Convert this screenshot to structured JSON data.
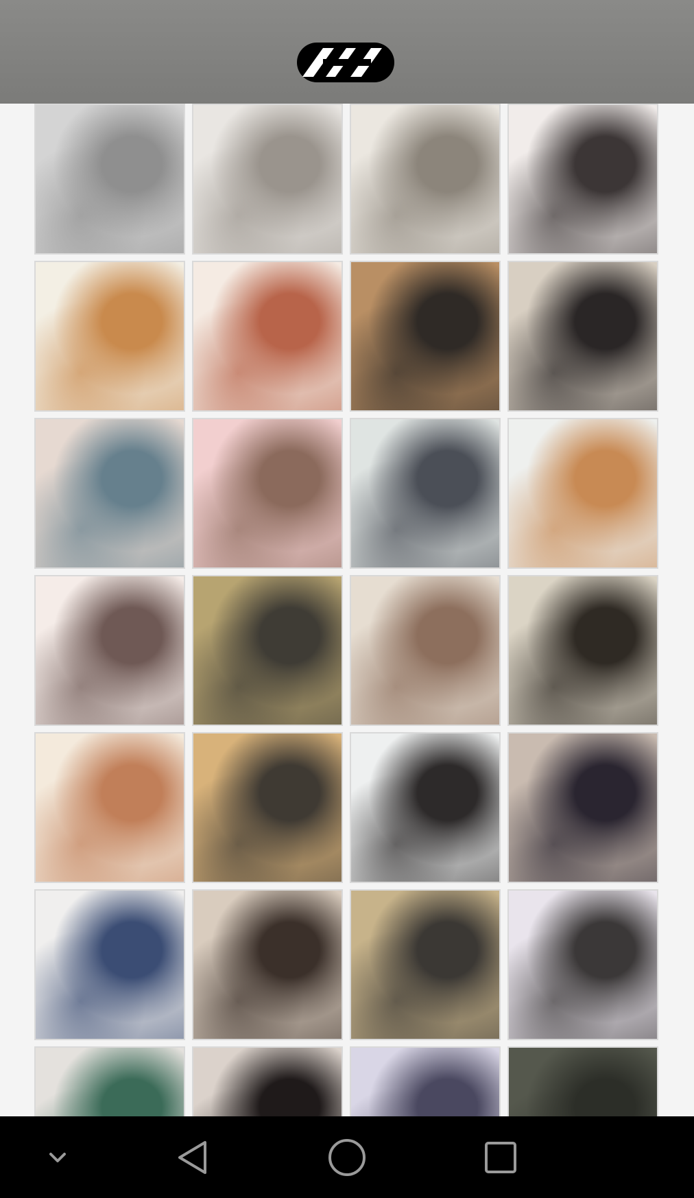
{
  "header": {
    "logo_icon": "app-logo-icon",
    "background": "#838381"
  },
  "gallery": {
    "columns": 4,
    "tiles": [
      {
        "icon": "photo-woman-grey-cat",
        "tone": [
          "#d4d4d4",
          "#8f8f8f"
        ]
      },
      {
        "icon": "photo-girl-cat-on-bed",
        "tone": [
          "#e9e6e2",
          "#9a948d"
        ]
      },
      {
        "icon": "photo-girl-cat-book",
        "tone": [
          "#ebe7e0",
          "#8c857b"
        ]
      },
      {
        "icon": "photo-girl-white-cat",
        "tone": [
          "#f1ecea",
          "#3c3636"
        ]
      },
      {
        "icon": "photo-girl-calico-cat",
        "tone": [
          "#f3efe4",
          "#c98a4d"
        ]
      },
      {
        "icon": "photo-redhead-cat",
        "tone": [
          "#f5ebe3",
          "#b8644a"
        ]
      },
      {
        "icon": "photo-girl-bookshelf-cat",
        "tone": [
          "#b98f64",
          "#2f2a26"
        ]
      },
      {
        "icon": "photo-girl-black-cat",
        "tone": [
          "#d8cfc2",
          "#2a2626"
        ]
      },
      {
        "icon": "photo-pier-sea",
        "tone": [
          "#e6d9d1",
          "#66808d"
        ]
      },
      {
        "icon": "photo-kitten-blanket",
        "tone": [
          "#f2cfcf",
          "#8b6a5c"
        ]
      },
      {
        "icon": "photo-girl-kissing-cat",
        "tone": [
          "#dfe4e2",
          "#4b4f57"
        ]
      },
      {
        "icon": "photo-girl-cats-sofa",
        "tone": [
          "#eef0ee",
          "#c88a54"
        ]
      },
      {
        "icon": "photo-girl-lying-white-cat",
        "tone": [
          "#f5ece8",
          "#6f5955"
        ]
      },
      {
        "icon": "photo-boy-cat-sunlight",
        "tone": [
          "#b7a471",
          "#3f3c35"
        ]
      },
      {
        "icon": "photo-girl-holding-cat-room",
        "tone": [
          "#e6ddd1",
          "#8d6f5d"
        ]
      },
      {
        "icon": "photo-girl-kitten-table",
        "tone": [
          "#dbd4c5",
          "#2f2a24"
        ]
      },
      {
        "icon": "photo-girl-kitten-close",
        "tone": [
          "#f4eadc",
          "#c17f59"
        ]
      },
      {
        "icon": "photo-girl-floor-cat",
        "tone": [
          "#d8b27a",
          "#3f3a33"
        ]
      },
      {
        "icon": "photo-girl-cat-car",
        "tone": [
          "#eef0f0",
          "#2d2a2a"
        ]
      },
      {
        "icon": "photo-girl-street-phone",
        "tone": [
          "#c9bbb0",
          "#2a2530"
        ]
      },
      {
        "icon": "photo-woman-kissing-cat",
        "tone": [
          "#f0efee",
          "#3b4d74"
        ]
      },
      {
        "icon": "photo-woman-hugging-cat",
        "tone": [
          "#d9ccbe",
          "#3b302a"
        ]
      },
      {
        "icon": "photo-girl-coat-street",
        "tone": [
          "#c7b38a",
          "#3b3834"
        ]
      },
      {
        "icon": "photo-girl-snowy-street",
        "tone": [
          "#e9e4ec",
          "#3b3838"
        ]
      },
      {
        "icon": "photo-girl-market",
        "tone": [
          "#e4e1dd",
          "#3b6b58"
        ]
      },
      {
        "icon": "photo-girl-glasses-cat",
        "tone": [
          "#dbd2cb",
          "#1f1a1a"
        ]
      },
      {
        "icon": "photo-girl-white-cat-forest",
        "tone": [
          "#d9d6e6",
          "#4a4860"
        ]
      },
      {
        "icon": "photo-city-street-dusk",
        "tone": [
          "#55584d",
          "#2c2e28"
        ]
      }
    ]
  },
  "nav_bar": {
    "background": "#000000",
    "buttons": [
      {
        "name": "hide-keyboard",
        "icon": "chevron-down-icon"
      },
      {
        "name": "back",
        "icon": "back-triangle-icon"
      },
      {
        "name": "home",
        "icon": "home-circle-icon"
      },
      {
        "name": "recents",
        "icon": "recents-square-icon"
      }
    ]
  }
}
